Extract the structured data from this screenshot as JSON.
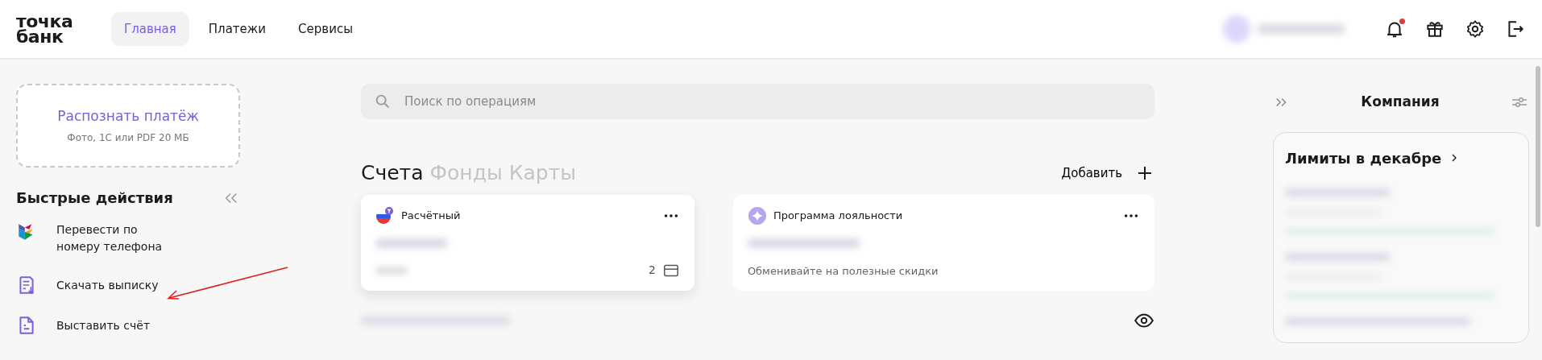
{
  "header": {
    "logo": [
      "точка",
      "банк"
    ],
    "nav": [
      {
        "label": "Главная",
        "selected": true
      },
      {
        "label": "Платежи",
        "selected": false
      },
      {
        "label": "Сервисы",
        "selected": false
      }
    ],
    "notifications": {
      "unread": true
    }
  },
  "left": {
    "recognize": {
      "title": "Распознать платёж",
      "subtitle": "Фото, 1С или PDF 20 МБ"
    },
    "quick_actions": {
      "title": "Быстрые действия",
      "items": [
        {
          "kind": "sbp",
          "label": "Перевести по номеру телефона"
        },
        {
          "kind": "statement",
          "label": "Скачать выписку"
        },
        {
          "kind": "invoice",
          "label": "Выставить счёт"
        }
      ]
    }
  },
  "center": {
    "search": {
      "placeholder": "Поиск по операциям"
    },
    "tabs": [
      {
        "label": "Счета",
        "selected": true
      },
      {
        "label": "Фонды",
        "selected": false
      },
      {
        "label": "Карты",
        "selected": false
      }
    ],
    "add_button": "Добавить",
    "accounts": [
      {
        "kind": "account",
        "name": "Расчётный",
        "cards_count": "2"
      },
      {
        "kind": "loyalty",
        "name": "Программа лояльности",
        "note": "Обменивайте на полезные скидки"
      }
    ]
  },
  "right": {
    "title": "Компания",
    "limits_title": "Лимиты в декабре"
  }
}
